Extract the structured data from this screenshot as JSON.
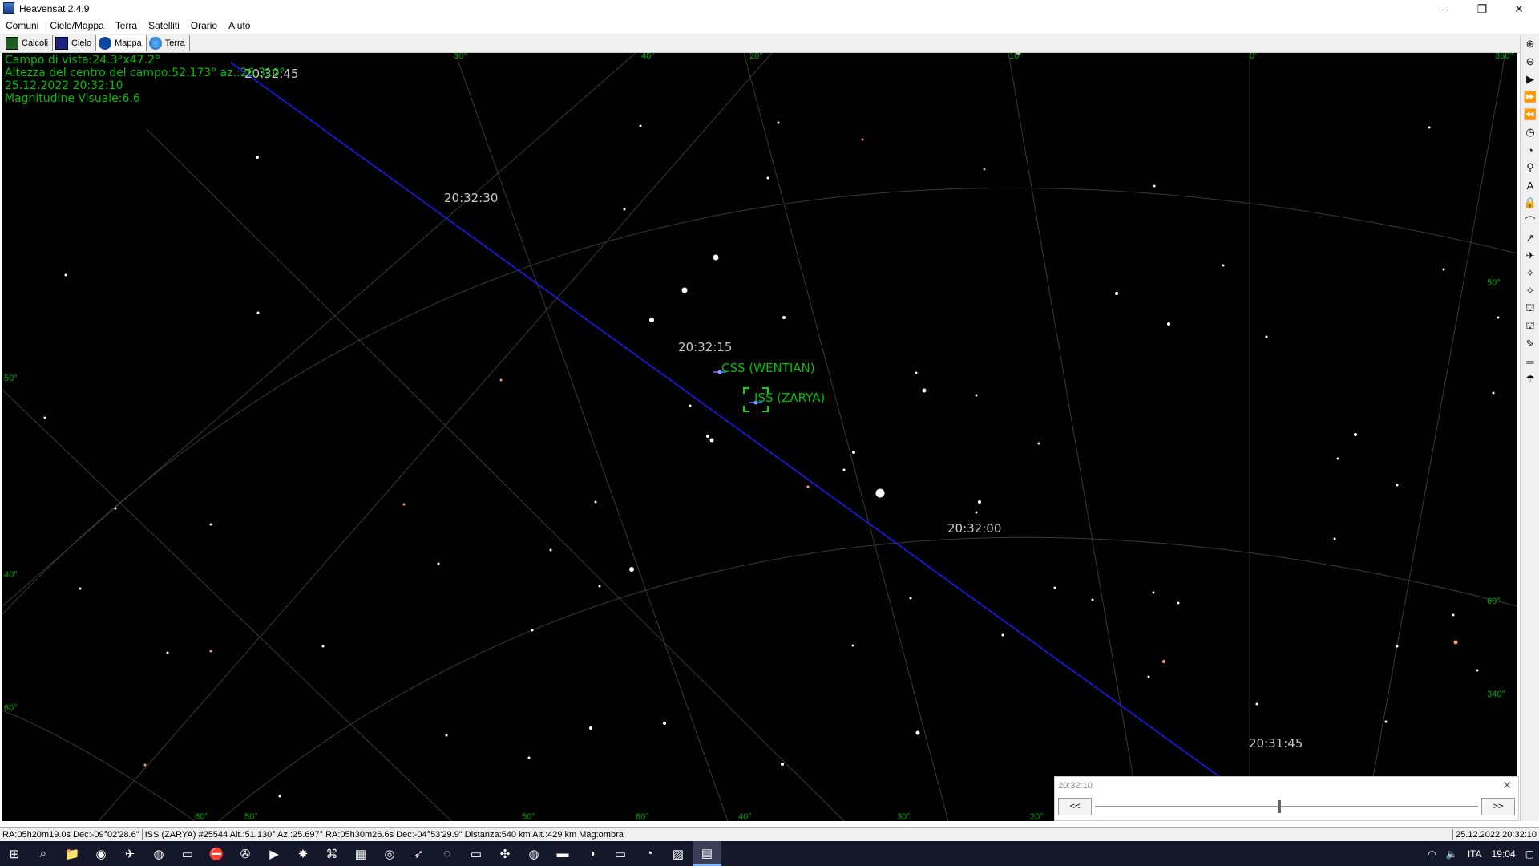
{
  "window": {
    "title": "Heavensat 2.4.9",
    "minimize": "–",
    "restore": "❐",
    "close": "✕"
  },
  "menu": [
    "Comuni",
    "Cielo/Mappa",
    "Terra",
    "Satelliti",
    "Orario",
    "Aiuto"
  ],
  "tabs": [
    {
      "label": "Calcoli",
      "icon": "calc-icon",
      "color": "#1b5e20"
    },
    {
      "label": "Cielo",
      "icon": "sky-icon",
      "color": "#1a237e"
    },
    {
      "label": "Mappa",
      "icon": "map-icon",
      "color": "#0d47a1"
    },
    {
      "label": "Terra",
      "icon": "earth-icon",
      "color": "#1565c0"
    }
  ],
  "info": {
    "fov": "Campo di vista:24.3°x47.2°",
    "center": "Altezza del centro del campo:52.173° az.:26.310°",
    "datetime": "25.12.2022 20:32:10",
    "magnitude": "Magnitudine Visuale:6.6"
  },
  "sky": {
    "time_labels": [
      "20:32:45",
      "20:32:30",
      "20:32:15",
      "20:32:00",
      "20:31:45"
    ],
    "sat1": "CSS (WENTIAN)",
    "sat2": "ISS (ZARYA)",
    "grid_labels": [
      "30°",
      "40°",
      "20°",
      "10°",
      "0°",
      "350°",
      "50°",
      "50°",
      "40°",
      "60°",
      "60°",
      "340°",
      "60°",
      "50°",
      "50°",
      "60°",
      "40°",
      "30°",
      "20°"
    ]
  },
  "right_tools": [
    "⊕",
    "⊖",
    "▶",
    "⏩",
    "⏪",
    "◷",
    "◔",
    "⚲",
    "A",
    "🔒",
    "⌒",
    "↗",
    "✈",
    "✧",
    "✧",
    "⛫",
    "⛫",
    "✎",
    "═",
    "☂"
  ],
  "status": {
    "ra_dec": "RA:05h20m19.0s Dec:-09°02'28.6\"",
    "sat_info": "ISS (ZARYA) #25544 Alt.:51.130°  Az.:25.697° RA:05h30m26.6s Dec:-04°53'29.9\" Distanza:540 km  Alt.:429 km  Mag:ombra",
    "datetime": "25.12.2022 20:32:10"
  },
  "timepanel": {
    "time": "20:32:10",
    "back": "<<",
    "fwd": ">>",
    "close": "✕",
    "position": 0.48
  },
  "taskbar": {
    "apps": [
      "⊞",
      "⌕",
      "📁",
      "◉",
      "✈",
      "◍",
      "▭",
      "⛔",
      "✇",
      "▶",
      "✸",
      "⌘",
      "▦",
      "◎",
      "➶",
      "◌",
      "▭",
      "✣",
      "◍",
      "▬",
      "◑",
      "▭",
      "◔",
      "▨",
      "▤"
    ],
    "lang": "ITA",
    "clock": "19:04"
  },
  "colors": {
    "track": "#1a1aff",
    "label_green": "#00c000",
    "time_label": "#c8c8c8",
    "grid": "#3a3a3a"
  }
}
